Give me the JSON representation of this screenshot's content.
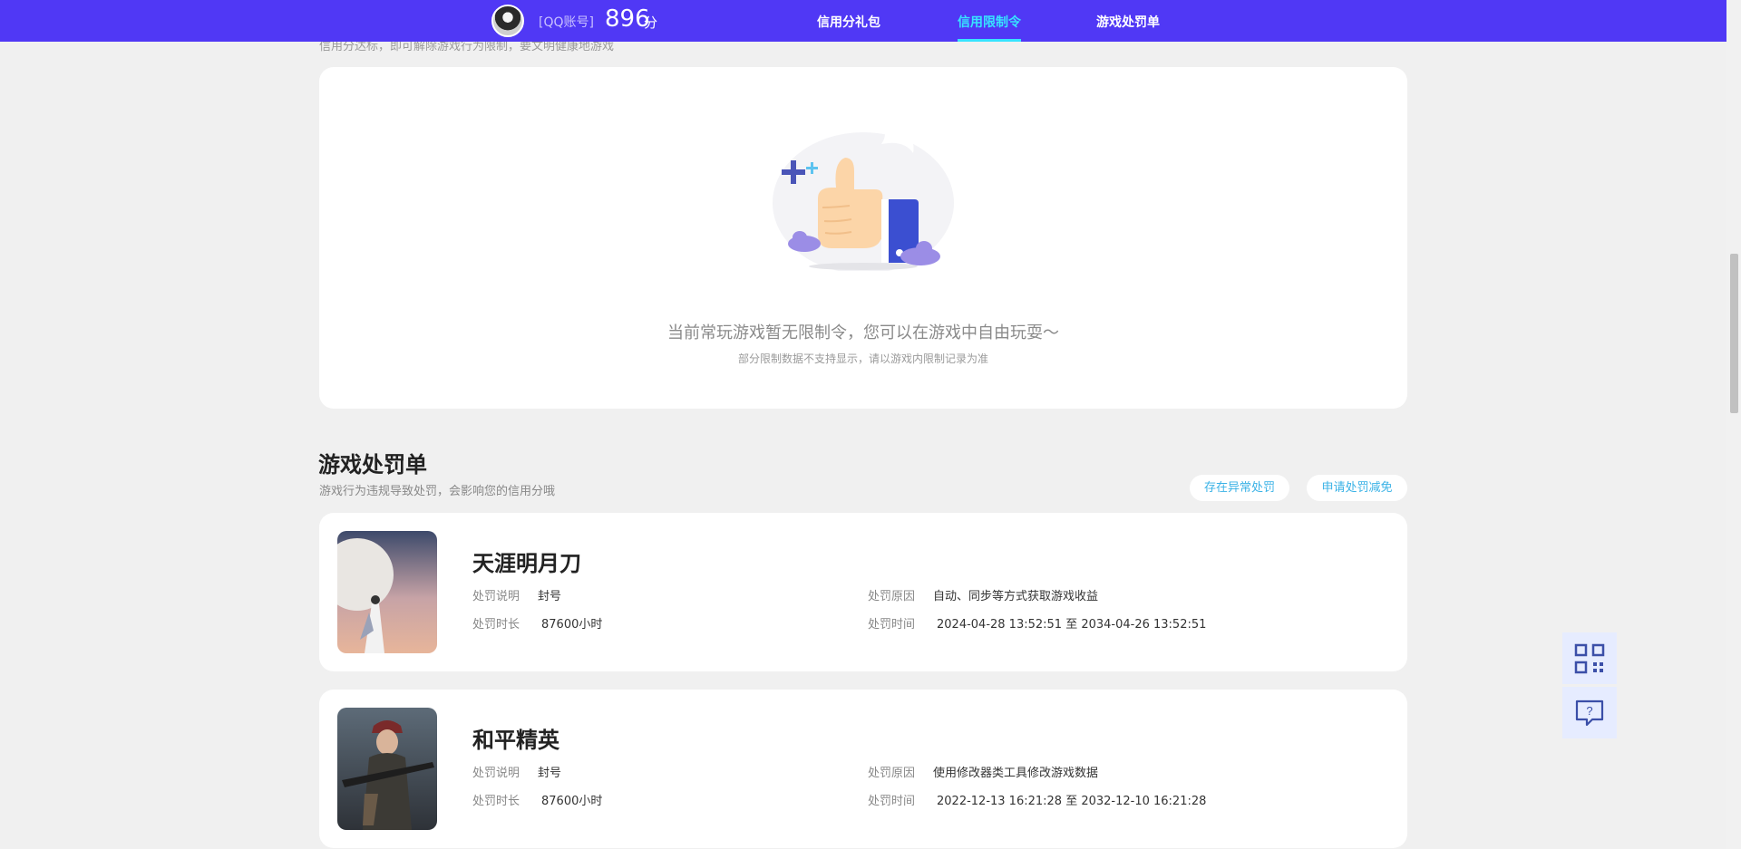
{
  "header": {
    "account_label": "[QQ账号]",
    "score": "896",
    "score_unit": "分",
    "tabs": [
      {
        "label": "信用分礼包"
      },
      {
        "label": "信用限制令"
      },
      {
        "label": "游戏处罚单"
      }
    ],
    "active_tab": "信用限制令"
  },
  "top_hint": "信用分达标，即可解除游戏行为限制，要文明健康地游戏",
  "empty_state": {
    "illustration": "thumbs-up-icon",
    "main_text": "当前常玩游戏暂无限制令，您可以在游戏中自由玩耍～",
    "sub_text": "部分限制数据不支持显示，请以游戏内限制记录为准"
  },
  "punishments": {
    "title": "游戏处罚单",
    "subtitle": "游戏行为违规导致处罚，会影响您的信用分哦",
    "buttons": {
      "abnormal": "存在异常处罚",
      "reduce": "申请处罚减免"
    },
    "field_labels": {
      "description": "处罚说明",
      "duration": "处罚时长",
      "reason": "处罚原因",
      "time": "处罚时间"
    },
    "items": [
      {
        "game": "天涯明月刀",
        "description": "封号",
        "duration": "87600小时",
        "reason": "自动、同步等方式获取游戏收益",
        "time": "2024-04-28 13:52:51 至 2034-04-26 13:52:51"
      },
      {
        "game": "和平精英",
        "description": "封号",
        "duration": "87600小时",
        "reason": "使用修改器类工具修改游戏数据",
        "time": "2022-12-13 16:21:28 至 2032-12-10 16:21:28"
      }
    ]
  },
  "floating": {
    "qr_icon": "qrcode-icon",
    "help_icon": "help-chat-icon"
  },
  "colors": {
    "header_bg": "#5038f5",
    "active_tab": "#37e4ff",
    "pill_text": "#3ab2e6",
    "page_bg": "#f0f0f0"
  }
}
